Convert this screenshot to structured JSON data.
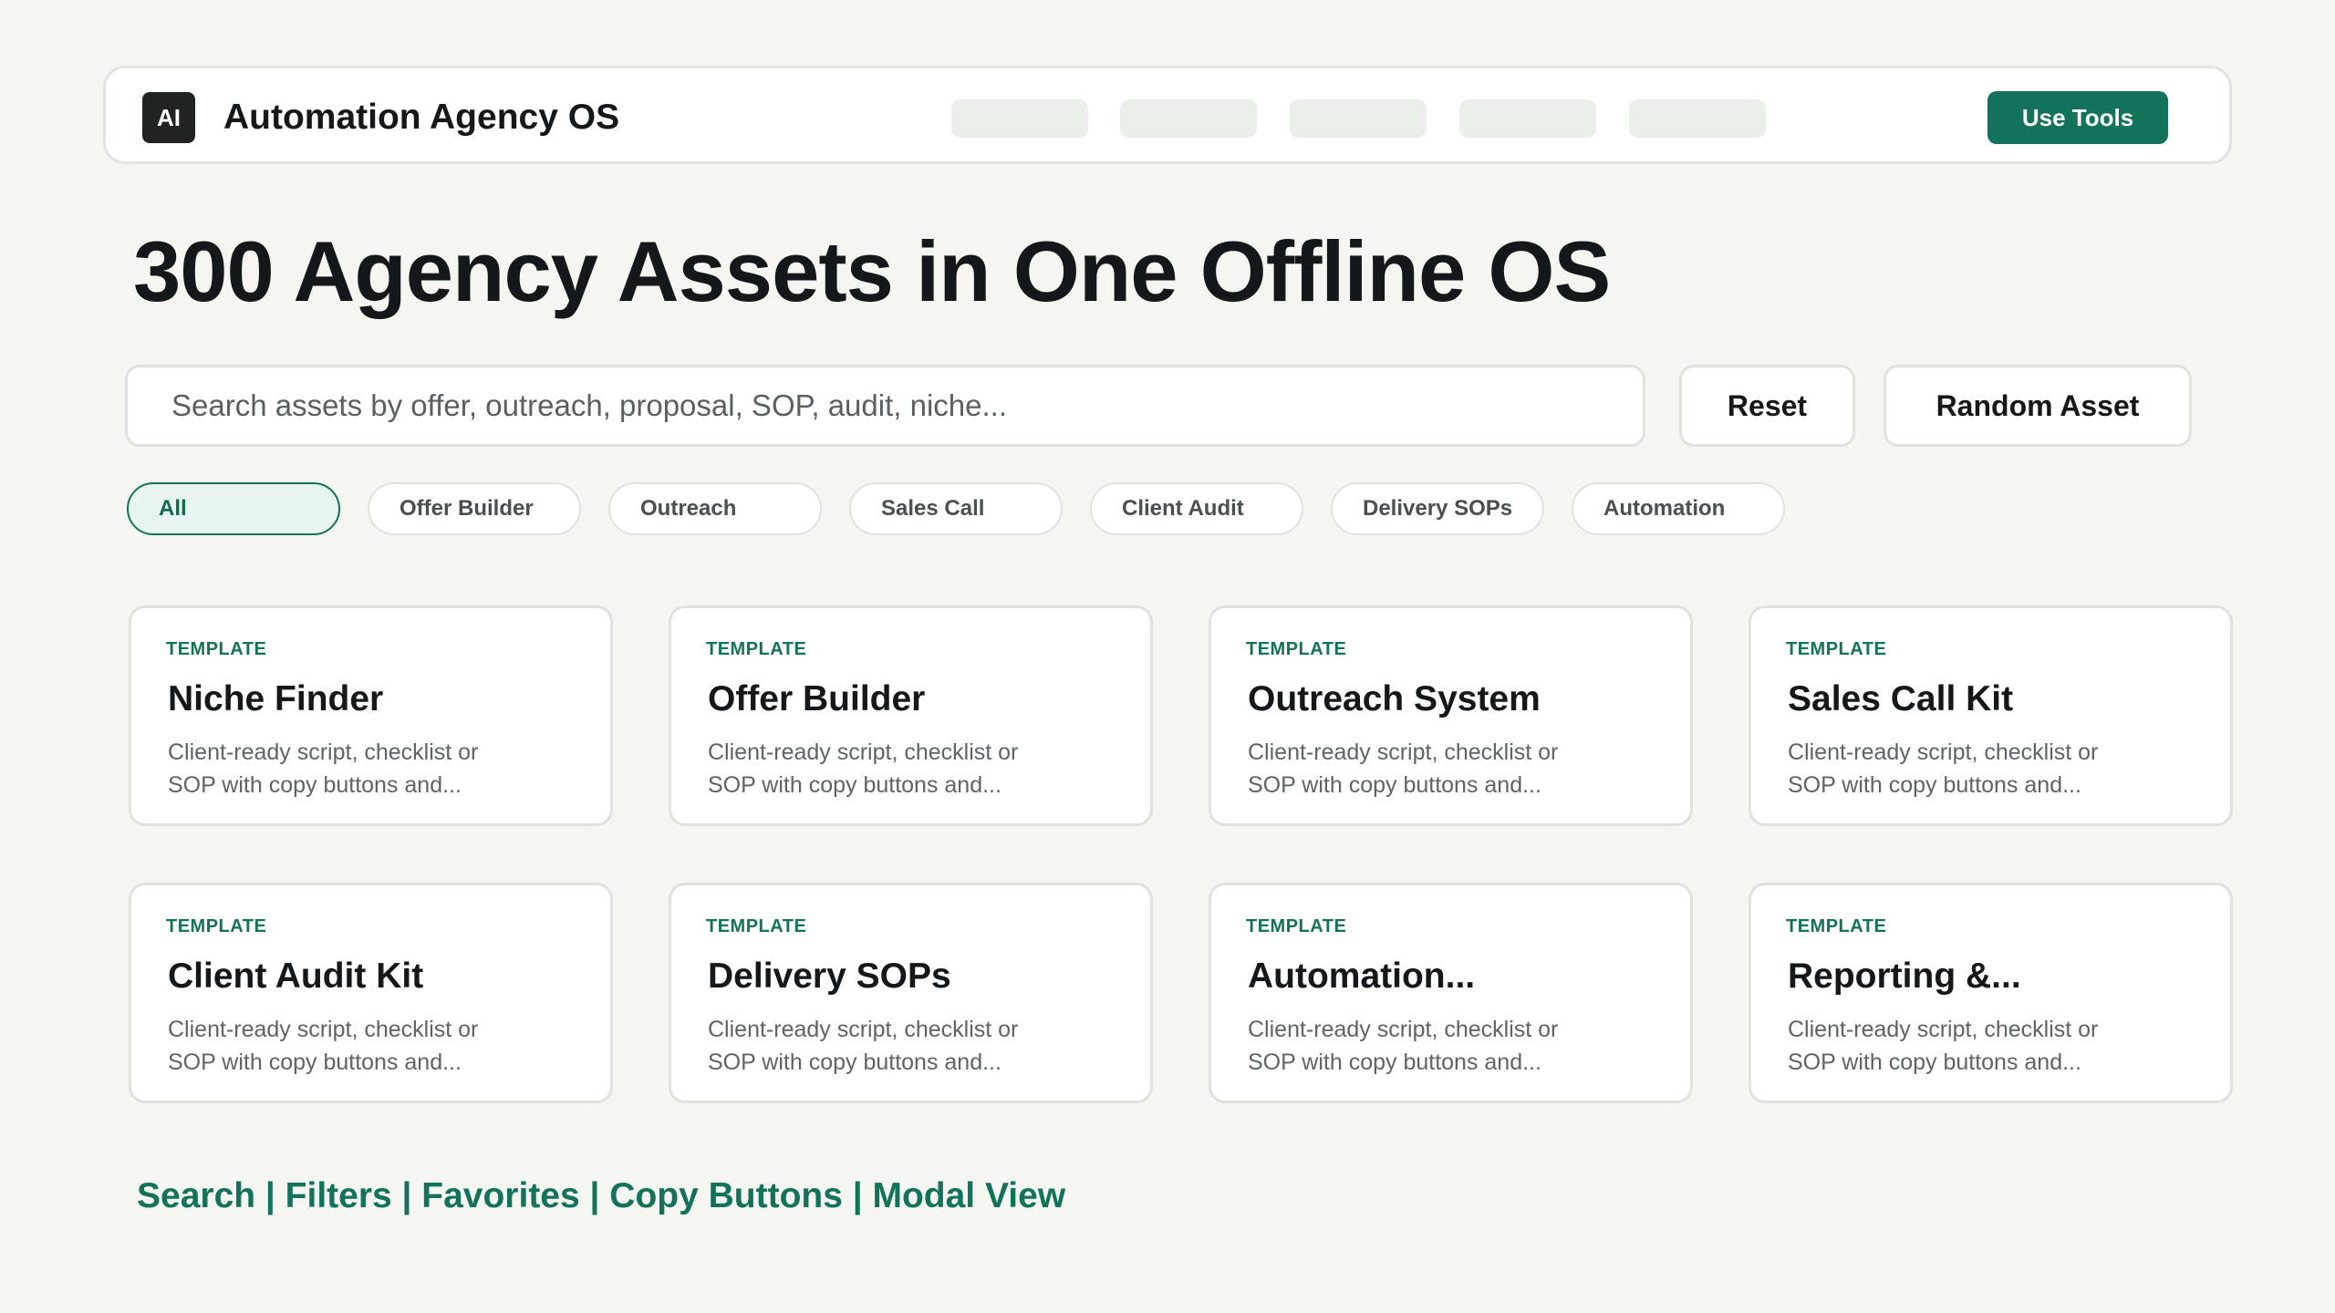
{
  "nav": {
    "logo": "AI",
    "title": "Automation Agency OS",
    "cta": "Use Tools"
  },
  "hero": {
    "title": "300 Agency Assets in One Offline OS"
  },
  "search": {
    "placeholder": "Search assets by offer, outreach, proposal, SOP, audit, niche...",
    "reset": "Reset",
    "random": "Random Asset"
  },
  "filters": [
    {
      "label": "All",
      "active": true
    },
    {
      "label": "Offer Builder",
      "active": false
    },
    {
      "label": "Outreach",
      "active": false
    },
    {
      "label": "Sales Call",
      "active": false
    },
    {
      "label": "Client Audit",
      "active": false
    },
    {
      "label": "Delivery SOPs",
      "active": false
    },
    {
      "label": "Automation",
      "active": false
    }
  ],
  "cards": [
    {
      "tag": "TEMPLATE",
      "title": "Niche Finder",
      "desc": "Client-ready script, checklist or SOP with copy buttons and..."
    },
    {
      "tag": "TEMPLATE",
      "title": "Offer Builder",
      "desc": "Client-ready script, checklist or SOP with copy buttons and..."
    },
    {
      "tag": "TEMPLATE",
      "title": "Outreach System",
      "desc": "Client-ready script, checklist or SOP with copy buttons and..."
    },
    {
      "tag": "TEMPLATE",
      "title": "Sales Call Kit",
      "desc": "Client-ready script, checklist or SOP with copy buttons and..."
    },
    {
      "tag": "TEMPLATE",
      "title": "Client Audit Kit",
      "desc": "Client-ready script, checklist or SOP with copy buttons and..."
    },
    {
      "tag": "TEMPLATE",
      "title": "Delivery SOPs",
      "desc": "Client-ready script, checklist or SOP with copy buttons and..."
    },
    {
      "tag": "TEMPLATE",
      "title": "Automation...",
      "desc": "Client-ready script, checklist or SOP with copy buttons and..."
    },
    {
      "tag": "TEMPLATE",
      "title": "Reporting &...",
      "desc": "Client-ready script, checklist or SOP with copy buttons and..."
    }
  ],
  "footer": {
    "features": "Search | Filters | Favorites | Copy Buttons | Modal View"
  },
  "colors": {
    "accent": "#12735a",
    "background": "#f5f5f1",
    "dark": "#1f2420"
  }
}
